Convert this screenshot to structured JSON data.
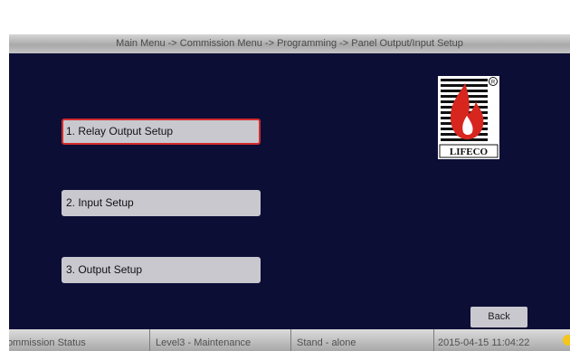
{
  "header": {
    "breadcrumb": "Main Menu -> Commission Menu -> Programming -> Panel Output/Input Setup"
  },
  "menu": {
    "items": [
      {
        "label": "1. Relay Output Setup",
        "selected": true
      },
      {
        "label": "2. Input Setup",
        "selected": false
      },
      {
        "label": "3. Output Setup",
        "selected": false
      }
    ]
  },
  "logo": {
    "text": "LIFECO",
    "registered_mark": "®"
  },
  "back_button": {
    "label": "Back"
  },
  "status_bar": {
    "commission_status": "Commission Status",
    "access_level": "Level3 - Maintenance",
    "mode": "Stand - alone",
    "datetime": "2015-04-15 11:04:22"
  },
  "colors": {
    "screen_background": "#0c0e36",
    "button_background": "#c9c8cf",
    "selected_border": "#d22b2b",
    "logo_red": "#d7261e",
    "status_icon": "#f5c51b"
  }
}
